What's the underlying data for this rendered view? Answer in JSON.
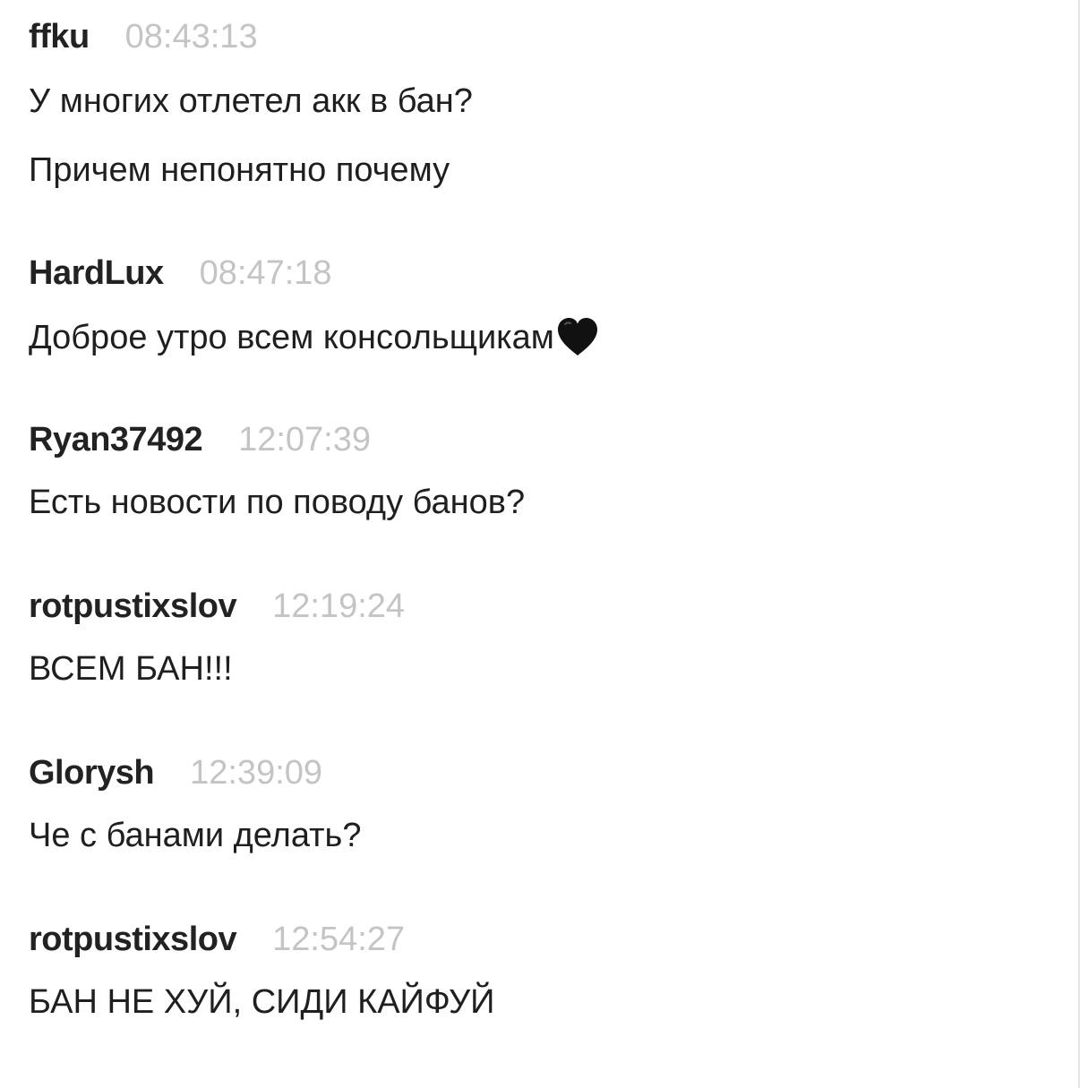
{
  "colors": {
    "background": "#ffffff",
    "username": "#222222",
    "timestamp": "#c4c4c4",
    "text": "#1f1f1f"
  },
  "messages": [
    {
      "user": "ffku",
      "time": "08:43:13",
      "lines": [
        "У многих отлетел акк в бан?",
        "Причем непонятно почему"
      ]
    },
    {
      "user": "HardLux",
      "time": "08:47:18",
      "lines": [
        "Доброе утро всем консольщикам"
      ],
      "emoji": "black-heart-icon"
    },
    {
      "user": "Ryan37492",
      "time": "12:07:39",
      "lines": [
        "Есть новости по поводу банов?"
      ]
    },
    {
      "user": "rotpustixslov",
      "time": "12:19:24",
      "lines": [
        "ВСЕМ БАН!!!"
      ]
    },
    {
      "user": "Glorysh",
      "time": "12:39:09",
      "lines": [
        "Че с банами делать?"
      ]
    },
    {
      "user": "rotpustixslov",
      "time": "12:54:27",
      "lines": [
        "БАН НЕ ХУЙ, СИДИ КАЙФУЙ"
      ]
    }
  ]
}
